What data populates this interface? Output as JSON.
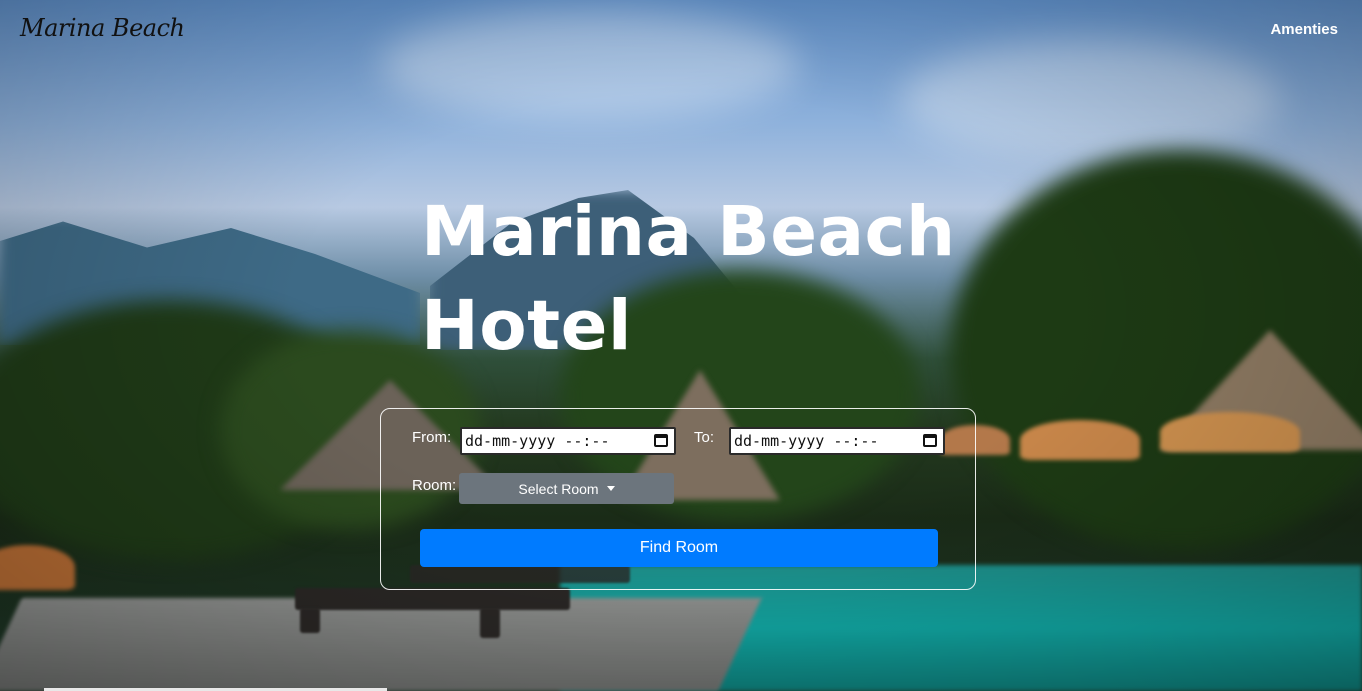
{
  "header": {
    "brand": "Marina Beach",
    "nav_amenities": "Amenties"
  },
  "hero": {
    "title_line1": "Marina Beach",
    "title_line2": "Hotel"
  },
  "booking": {
    "from_label": "From:",
    "from_value": "dd-mm-yyyy --:--",
    "to_label": "To:",
    "to_value": "dd-mm-yyyy --:--",
    "room_label": "Room:",
    "room_select": "Select Room",
    "submit": "Find Room"
  },
  "colors": {
    "primary": "#007bff",
    "secondary": "#6c757d"
  },
  "icons": {
    "date_picker": "calendar-icon",
    "dropdown": "caret-down-icon"
  }
}
